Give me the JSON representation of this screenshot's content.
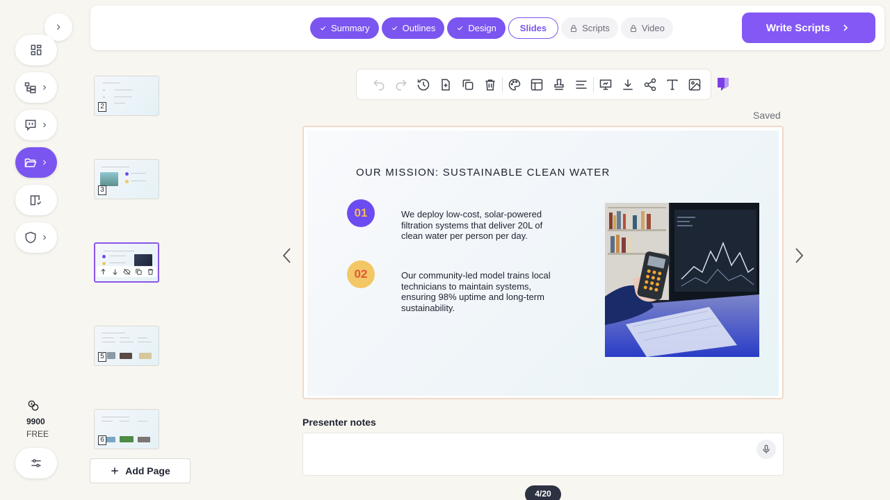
{
  "colors": {
    "accent": "#7b55f0",
    "step_done_bg": "#7b55f0",
    "bullet1_bg": "#6c4cf0",
    "bullet1_fg": "#f0b95a",
    "bullet2_bg": "#f3c766",
    "bullet2_fg": "#e1563a"
  },
  "workflow": {
    "steps": [
      {
        "label": "Summary",
        "state": "done",
        "icon": "check-icon"
      },
      {
        "label": "Outlines",
        "state": "done",
        "icon": "check-icon"
      },
      {
        "label": "Design",
        "state": "done",
        "icon": "check-icon"
      },
      {
        "label": "Slides",
        "state": "current"
      },
      {
        "label": "Scripts",
        "state": "locked",
        "icon": "lock-icon"
      },
      {
        "label": "Video",
        "state": "locked",
        "icon": "lock-icon"
      }
    ],
    "primary_action": "Write Scripts"
  },
  "sidebar": {
    "items": [
      {
        "icon": "dashboard-grid-icon",
        "has_submenu": false
      },
      {
        "icon": "hierarchy-tree-icon",
        "has_submenu": true
      },
      {
        "icon": "chat-bubble-icon",
        "has_submenu": true
      },
      {
        "icon": "folder-open-icon",
        "has_submenu": true,
        "active": true
      },
      {
        "icon": "book-check-icon",
        "has_submenu": false
      },
      {
        "icon": "shield-icon",
        "has_submenu": true
      }
    ],
    "credits": {
      "icon": "coins-icon",
      "amount": "9900",
      "plan": "FREE"
    },
    "settings_icon": "sliders-icon"
  },
  "thumbnails": [
    {
      "page": "2"
    },
    {
      "page": "3"
    },
    {
      "page": "4",
      "active": true
    },
    {
      "page": "5"
    },
    {
      "page": "6"
    }
  ],
  "add_page_label": "Add Page",
  "toolbar": {
    "tools": [
      "undo-icon",
      "redo-icon",
      "history-icon",
      "add-slide-icon",
      "duplicate-icon",
      "delete-icon",
      "palette-icon",
      "layout-icon",
      "stamp-icon",
      "align-icon",
      "present-icon",
      "download-icon",
      "share-icon",
      "text-icon",
      "image-icon"
    ]
  },
  "save_status": "Saved",
  "slide": {
    "title": "OUR MISSION: SUSTAINABLE CLEAN WATER",
    "points": [
      {
        "number": "01",
        "text": "We deploy low-cost, solar-powered filtration systems that deliver 20L of clean water per person per day."
      },
      {
        "number": "02",
        "text": "Our community-led model trains local technicians to maintain systems, ensuring 98% uptime and long-term sustainability."
      }
    ]
  },
  "notes": {
    "label": "Presenter notes",
    "value": ""
  },
  "pager": "4/20"
}
